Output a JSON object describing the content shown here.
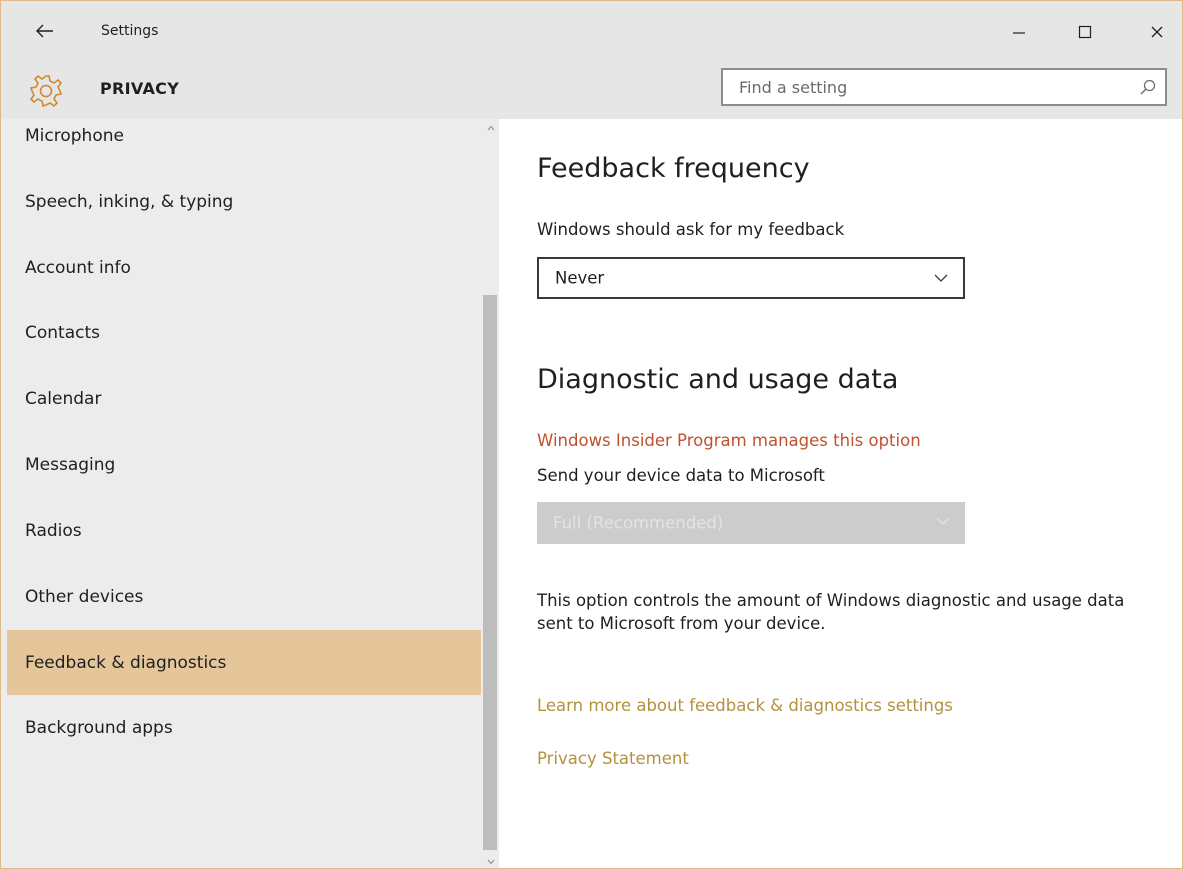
{
  "window": {
    "title": "Settings",
    "controls": [
      "minimize",
      "maximize",
      "close"
    ]
  },
  "header": {
    "section_title": "PRIVACY",
    "icon": "gear-icon",
    "search": {
      "placeholder": "Find a setting",
      "value": "",
      "icon": "search-icon"
    }
  },
  "sidebar": {
    "items": [
      {
        "label": "Microphone",
        "selected": false
      },
      {
        "label": "Speech, inking, & typing",
        "selected": false
      },
      {
        "label": "Account info",
        "selected": false
      },
      {
        "label": "Contacts",
        "selected": false
      },
      {
        "label": "Calendar",
        "selected": false
      },
      {
        "label": "Messaging",
        "selected": false
      },
      {
        "label": "Radios",
        "selected": false
      },
      {
        "label": "Other devices",
        "selected": false
      },
      {
        "label": "Feedback & diagnostics",
        "selected": true
      },
      {
        "label": "Background apps",
        "selected": false
      }
    ]
  },
  "content": {
    "feedback": {
      "heading": "Feedback frequency",
      "label": "Windows should ask for my feedback",
      "selected_option": "Never"
    },
    "diagnostics": {
      "heading": "Diagnostic and usage data",
      "managed_note": "Windows Insider Program manages this option",
      "label": "Send your device data to Microsoft",
      "selected_option": "Full (Recommended)",
      "disabled": true,
      "description": "This option controls the amount of Windows diagnostic and usage data sent to Microsoft from your device."
    },
    "links": {
      "learn_more": "Learn more about feedback & diagnostics settings",
      "privacy_statement": "Privacy Statement"
    }
  },
  "colors": {
    "accent": "#e5c69a",
    "link": "#b5913f",
    "warning_text": "#c1502e",
    "chrome": "#e6e6e6",
    "sidebar_bg": "#ececec"
  }
}
